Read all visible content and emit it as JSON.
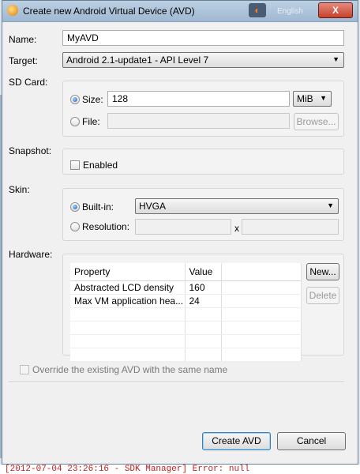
{
  "window": {
    "title": "Create new Android Virtual Device (AVD)",
    "language": "English",
    "close_label": "X"
  },
  "form": {
    "name_label": "Name:",
    "name_value": "MyAVD",
    "target_label": "Target:",
    "target_value": "Android 2.1-update1 - API Level 7"
  },
  "sdcard": {
    "label": "SD Card:",
    "size_label": "Size:",
    "size_value": "128",
    "unit_value": "MiB",
    "file_label": "File:",
    "browse_label": "Browse..."
  },
  "snapshot": {
    "label": "Snapshot:",
    "enabled_label": "Enabled"
  },
  "skin": {
    "label": "Skin:",
    "builtin_label": "Built-in:",
    "builtin_value": "HVGA",
    "resolution_label": "Resolution:",
    "x_label": "x"
  },
  "hardware": {
    "label": "Hardware:",
    "columns": [
      "Property",
      "Value"
    ],
    "rows": [
      {
        "property": "Abstracted LCD density",
        "value": "160"
      },
      {
        "property": "Max VM application hea...",
        "value": "24"
      }
    ],
    "new_label": "New...",
    "delete_label": "Delete"
  },
  "override_label": "Override the existing AVD with the same name",
  "buttons": {
    "create_label": "Create AVD",
    "cancel_label": "Cancel"
  },
  "background_log": "[2012-07-04 23:26:16 - SDK Manager] Error: null"
}
